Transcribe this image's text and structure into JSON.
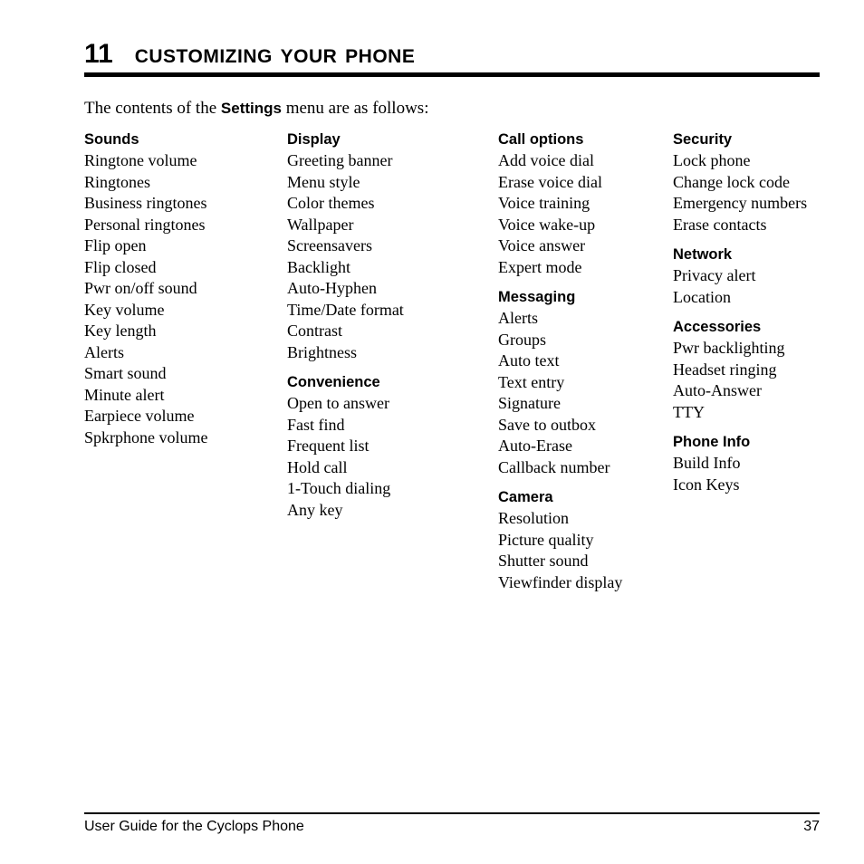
{
  "chapter": {
    "number": "11",
    "title": "Customizing Your Phone"
  },
  "intro": {
    "before": "The contents of the ",
    "bold": "Settings",
    "after": " menu are as follows:"
  },
  "columns": [
    {
      "groups": [
        {
          "title": "Sounds",
          "items": [
            "Ringtone volume",
            "Ringtones",
            "Business ringtones",
            "Personal ringtones",
            "Flip open",
            "Flip closed",
            "Pwr on/off sound",
            "Key volume",
            "Key length",
            "Alerts",
            "Smart sound",
            "Minute alert",
            "Earpiece volume",
            "Spkrphone volume"
          ]
        }
      ]
    },
    {
      "groups": [
        {
          "title": "Display",
          "items": [
            "Greeting banner",
            "Menu style",
            "Color themes",
            "Wallpaper",
            "Screensavers",
            "Backlight",
            "Auto-Hyphen",
            "Time/Date format",
            "Contrast",
            "Brightness"
          ]
        },
        {
          "title": "Convenience",
          "items": [
            "Open to answer",
            "Fast find",
            "Frequent list",
            "Hold call",
            "1-Touch dialing",
            "Any key"
          ]
        }
      ]
    },
    {
      "groups": [
        {
          "title": "Call options",
          "items": [
            "Add voice dial",
            "Erase voice dial",
            "Voice training",
            "Voice wake-up",
            "Voice answer",
            "Expert mode"
          ]
        },
        {
          "title": "Messaging",
          "items": [
            "Alerts",
            "Groups",
            "Auto text",
            "Text entry",
            "Signature",
            "Save to outbox",
            "Auto-Erase",
            "Callback number"
          ]
        },
        {
          "title": "Camera",
          "items": [
            "Resolution",
            "Picture quality",
            "Shutter sound",
            "Viewfinder display"
          ]
        }
      ]
    },
    {
      "groups": [
        {
          "title": "Security",
          "items": [
            "Lock phone",
            "Change lock code",
            "Emergency numbers",
            "Erase contacts"
          ]
        },
        {
          "title": "Network",
          "items": [
            "Privacy alert",
            "Location"
          ]
        },
        {
          "title": "Accessories",
          "items": [
            "Pwr backlighting",
            "Headset ringing",
            "Auto-Answer",
            "TTY"
          ]
        },
        {
          "title": "Phone Info",
          "items": [
            "Build Info",
            "Icon Keys"
          ]
        }
      ]
    }
  ],
  "footer": {
    "title": "User Guide for the Cyclops Phone",
    "page": "37"
  }
}
